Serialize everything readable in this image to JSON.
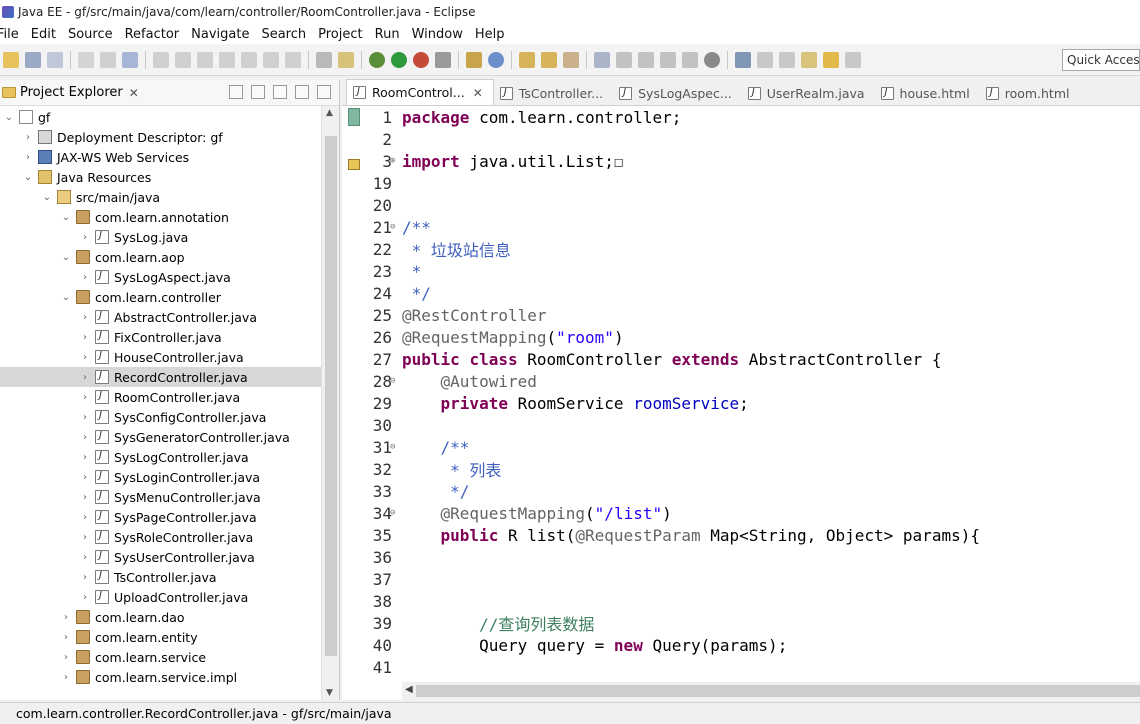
{
  "window": {
    "title": "Java EE - gf/src/main/java/com/learn/controller/RoomController.java - Eclipse"
  },
  "menu": {
    "items": [
      "File",
      "Edit",
      "Source",
      "Refactor",
      "Navigate",
      "Search",
      "Project",
      "Run",
      "Window",
      "Help"
    ]
  },
  "toolbar": {
    "quick_access": "Quick Access"
  },
  "explorer": {
    "tab": "Project Explorer",
    "tree": [
      {
        "label": "gf",
        "indent": 0,
        "tw": "⌄",
        "icon": "proj"
      },
      {
        "label": "Deployment Descriptor: gf",
        "indent": 1,
        "tw": "›",
        "icon": "dd"
      },
      {
        "label": "JAX-WS Web Services",
        "indent": 1,
        "tw": "›",
        "icon": "ws"
      },
      {
        "label": "Java Resources",
        "indent": 1,
        "tw": "⌄",
        "icon": "res"
      },
      {
        "label": "src/main/java",
        "indent": 2,
        "tw": "⌄",
        "icon": "src"
      },
      {
        "label": "com.learn.annotation",
        "indent": 3,
        "tw": "⌄",
        "icon": "pkg"
      },
      {
        "label": "SysLog.java",
        "indent": 4,
        "tw": "›",
        "icon": "java"
      },
      {
        "label": "com.learn.aop",
        "indent": 3,
        "tw": "⌄",
        "icon": "pkg"
      },
      {
        "label": "SysLogAspect.java",
        "indent": 4,
        "tw": "›",
        "icon": "java"
      },
      {
        "label": "com.learn.controller",
        "indent": 3,
        "tw": "⌄",
        "icon": "pkg"
      },
      {
        "label": "AbstractController.java",
        "indent": 4,
        "tw": "›",
        "icon": "java"
      },
      {
        "label": "FixController.java",
        "indent": 4,
        "tw": "›",
        "icon": "java"
      },
      {
        "label": "HouseController.java",
        "indent": 4,
        "tw": "›",
        "icon": "java"
      },
      {
        "label": "RecordController.java",
        "indent": 4,
        "tw": "›",
        "icon": "java",
        "selected": true
      },
      {
        "label": "RoomController.java",
        "indent": 4,
        "tw": "›",
        "icon": "java"
      },
      {
        "label": "SysConfigController.java",
        "indent": 4,
        "tw": "›",
        "icon": "java"
      },
      {
        "label": "SysGeneratorController.java",
        "indent": 4,
        "tw": "›",
        "icon": "java"
      },
      {
        "label": "SysLogController.java",
        "indent": 4,
        "tw": "›",
        "icon": "java"
      },
      {
        "label": "SysLoginController.java",
        "indent": 4,
        "tw": "›",
        "icon": "java"
      },
      {
        "label": "SysMenuController.java",
        "indent": 4,
        "tw": "›",
        "icon": "java"
      },
      {
        "label": "SysPageController.java",
        "indent": 4,
        "tw": "›",
        "icon": "java"
      },
      {
        "label": "SysRoleController.java",
        "indent": 4,
        "tw": "›",
        "icon": "java"
      },
      {
        "label": "SysUserController.java",
        "indent": 4,
        "tw": "›",
        "icon": "java"
      },
      {
        "label": "TsController.java",
        "indent": 4,
        "tw": "›",
        "icon": "java"
      },
      {
        "label": "UploadController.java",
        "indent": 4,
        "tw": "›",
        "icon": "java"
      },
      {
        "label": "com.learn.dao",
        "indent": 3,
        "tw": "›",
        "icon": "pkg"
      },
      {
        "label": "com.learn.entity",
        "indent": 3,
        "tw": "›",
        "icon": "pkg"
      },
      {
        "label": "com.learn.service",
        "indent": 3,
        "tw": "›",
        "icon": "pkg"
      },
      {
        "label": "com.learn.service.impl",
        "indent": 3,
        "tw": "›",
        "icon": "pkg"
      }
    ]
  },
  "editor": {
    "tabs": [
      {
        "label": "RoomControl...",
        "active": true
      },
      {
        "label": "TsController...",
        "active": false
      },
      {
        "label": "SysLogAspec...",
        "active": false
      },
      {
        "label": "UserRealm.java",
        "active": false
      },
      {
        "label": "house.html",
        "active": false
      },
      {
        "label": "room.html",
        "active": false
      }
    ],
    "lines": [
      {
        "n": "1",
        "fold": "",
        "html": "<span class='kw'>package</span> com.learn.controller;"
      },
      {
        "n": "2",
        "fold": "",
        "html": ""
      },
      {
        "n": "3",
        "fold": "⊕",
        "html": "<span class='kw'>import</span> java.util.List;☐"
      },
      {
        "n": "19",
        "fold": "",
        "html": ""
      },
      {
        "n": "20",
        "fold": "",
        "html": ""
      },
      {
        "n": "21",
        "fold": "⊖",
        "html": "<span class='cm'>/**</span>"
      },
      {
        "n": "22",
        "fold": "",
        "html": "<span class='cm'> * 垃圾站信息</span>"
      },
      {
        "n": "23",
        "fold": "",
        "html": "<span class='cm'> *</span>"
      },
      {
        "n": "24",
        "fold": "",
        "html": "<span class='cm'> */</span>"
      },
      {
        "n": "25",
        "fold": "",
        "html": "<span class='ann'>@RestController</span>"
      },
      {
        "n": "26",
        "fold": "",
        "html": "<span class='ann'>@RequestMapping</span>(<span class='str'>\"room\"</span>)"
      },
      {
        "n": "27",
        "fold": "",
        "html": "<span class='kw'>public</span> <span class='kw'>class</span> RoomController <span class='kw'>extends</span> AbstractController {"
      },
      {
        "n": "28",
        "fold": "⊖",
        "html": "    <span class='ann'>@Autowired</span>"
      },
      {
        "n": "29",
        "fold": "",
        "html": "    <span class='kw'>private</span> RoomService <span class='fld'>roomService</span>;"
      },
      {
        "n": "30",
        "fold": "",
        "html": ""
      },
      {
        "n": "31",
        "fold": "⊖",
        "html": "    <span class='cm'>/**</span>"
      },
      {
        "n": "32",
        "fold": "",
        "html": "<span class='cm'>     * 列表</span>"
      },
      {
        "n": "33",
        "fold": "",
        "html": "<span class='cm'>     */</span>"
      },
      {
        "n": "34",
        "fold": "⊖",
        "html": "    <span class='ann'>@RequestMapping</span>(<span class='str'>\"/list\"</span>)"
      },
      {
        "n": "35",
        "fold": "",
        "html": "    <span class='kw'>public</span> R list(<span class='ann'>@RequestParam</span> Map&lt;String, Object&gt; params){"
      },
      {
        "n": "36",
        "fold": "",
        "html": ""
      },
      {
        "n": "37",
        "fold": "",
        "html": ""
      },
      {
        "n": "38",
        "fold": "",
        "html": ""
      },
      {
        "n": "39",
        "fold": "",
        "html": "        <span class='cmg'>//查询列表数据</span>"
      },
      {
        "n": "40",
        "fold": "",
        "html": "        Query query = <span class='kw'>new</span> Query(params);"
      },
      {
        "n": "41",
        "fold": "",
        "html": ""
      }
    ]
  },
  "status": {
    "text": "com.learn.controller.RecordController.java - gf/src/main/java"
  }
}
